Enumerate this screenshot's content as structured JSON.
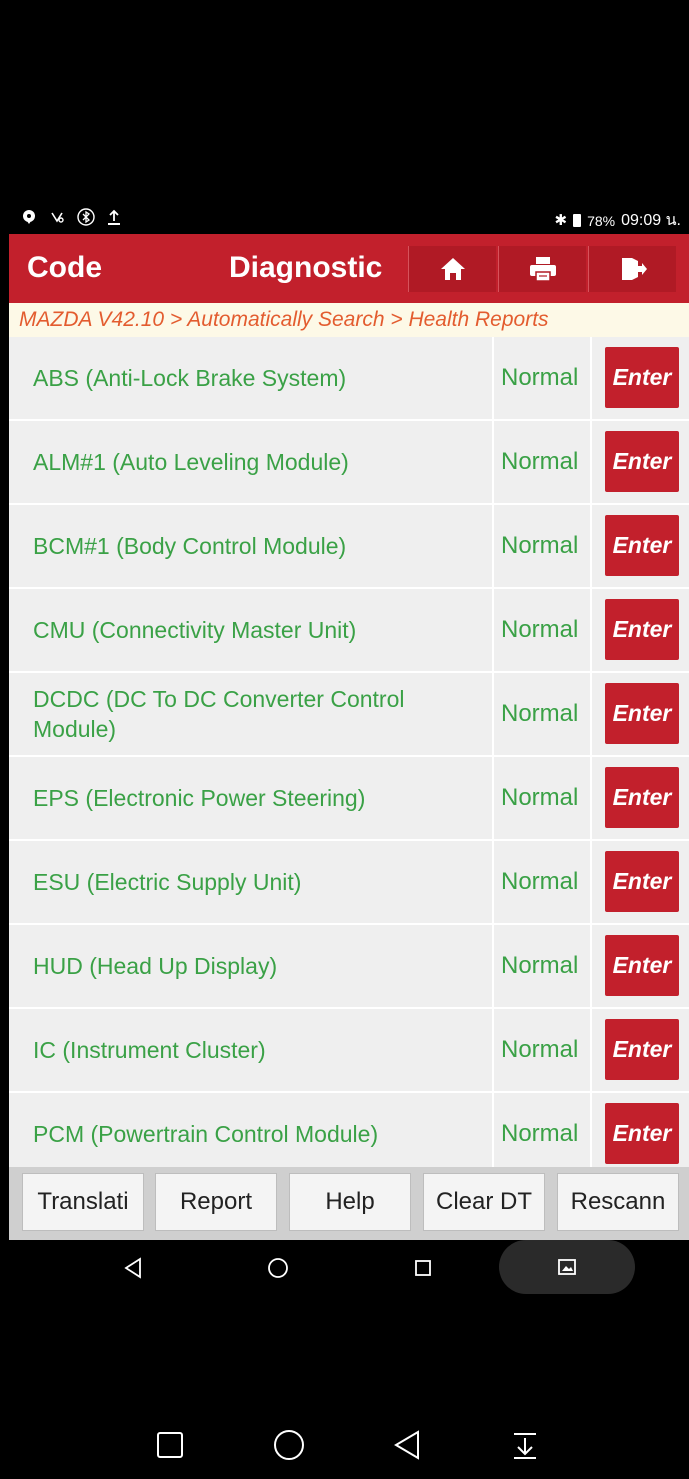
{
  "status_bar": {
    "left_icons": [
      "chat-icon",
      "vibrate-icon",
      "bluetooth-circle-icon",
      "upload-icon"
    ],
    "battery_percent": "78%",
    "time": "09:09 น."
  },
  "header": {
    "title_left": "Code",
    "title_main": "Diagnostic",
    "buttons": [
      "home-icon",
      "print-icon",
      "exit-icon"
    ],
    "color": "#c2202c"
  },
  "breadcrumb": "MAZDA V42.10 > Automatically Search > Health Reports",
  "modules": [
    {
      "name": "ABS (Anti-Lock Brake System)",
      "status": "Normal",
      "action": "Enter"
    },
    {
      "name": "ALM#1 (Auto Leveling Module)",
      "status": "Normal",
      "action": "Enter"
    },
    {
      "name": "BCM#1 (Body Control Module)",
      "status": "Normal",
      "action": "Enter"
    },
    {
      "name": "CMU (Connectivity Master Unit)",
      "status": "Normal",
      "action": "Enter"
    },
    {
      "name": "DCDC (DC To DC Converter Control Module)",
      "status": "Normal",
      "action": "Enter"
    },
    {
      "name": "EPS (Electronic Power Steering)",
      "status": "Normal",
      "action": "Enter"
    },
    {
      "name": "ESU (Electric Supply Unit)",
      "status": "Normal",
      "action": "Enter"
    },
    {
      "name": "HUD (Head Up Display)",
      "status": "Normal",
      "action": "Enter"
    },
    {
      "name": "IC (Instrument Cluster)",
      "status": "Normal",
      "action": "Enter"
    },
    {
      "name": "PCM (Powertrain Control Module)",
      "status": "Normal",
      "action": "Enter"
    }
  ],
  "toolbar": {
    "translate": "Translati",
    "report": "Report",
    "help": "Help",
    "clear": "Clear DT",
    "rescan": "Rescann"
  },
  "nav": {
    "top": [
      "back-icon",
      "home-circle-icon",
      "recents-icon",
      "screenshot-icon"
    ],
    "bottom": [
      "recents-square-icon",
      "home-circle-icon",
      "back-icon",
      "notification-pull-icon"
    ]
  },
  "colors": {
    "accent": "#c2202c",
    "status_green": "#3aa146",
    "breadcrumb_text": "#e35c2f"
  }
}
